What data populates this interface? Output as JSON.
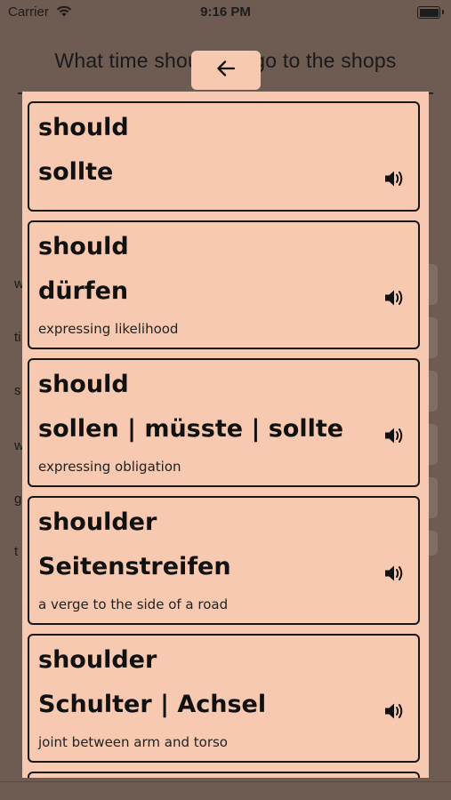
{
  "status_bar": {
    "carrier": "Carrier",
    "time": "9:16 PM"
  },
  "sentence": "What time should we go to the shops",
  "background_list": [
    "w",
    "ti",
    "s",
    "w",
    "g",
    "t"
  ],
  "back_button": {
    "icon": "arrow-left-icon"
  },
  "cards": [
    {
      "word": "should",
      "translation": "sollte",
      "note": ""
    },
    {
      "word": "should",
      "translation": "dürfen",
      "note": "expressing likelihood"
    },
    {
      "word": "should",
      "translation": "sollen | müsste | sollte",
      "note": "expressing obligation"
    },
    {
      "word": "shoulder",
      "translation": "Seitenstreifen",
      "note": "a verge to the side of a road"
    },
    {
      "word": "shoulder",
      "translation": "Schulter | Achsel",
      "note": "joint between arm and torso"
    }
  ],
  "colors": {
    "background": "#6e5c52",
    "panel": "#f6c9b0",
    "border": "#161616"
  }
}
